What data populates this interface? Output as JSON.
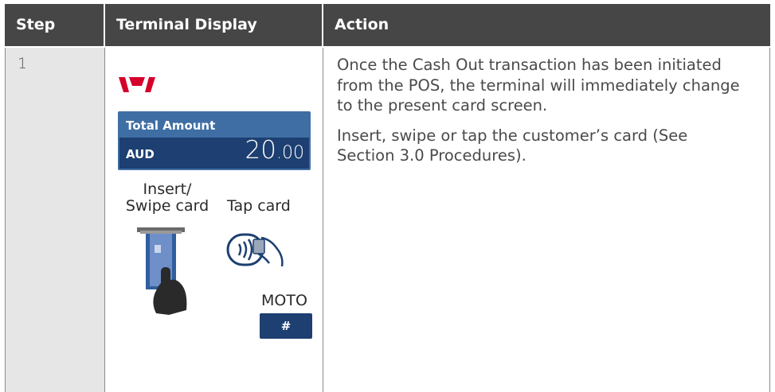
{
  "table": {
    "headers": {
      "step": "Step",
      "display": "Terminal Display",
      "action": "Action"
    },
    "rows": [
      {
        "step": "1",
        "display": {
          "amount_label": "Total Amount",
          "currency": "AUD",
          "amount_whole": "20",
          "amount_cents": ".00",
          "insert_label_line1": "Insert/",
          "insert_label_line2": "Swipe card",
          "tap_label": "Tap card",
          "moto_label": "MOTO",
          "moto_key": "#"
        },
        "action": {
          "paragraph1": "Once the Cash Out transaction has been initiated from the POS, the terminal will immediately change to the present card screen.",
          "paragraph2": "Insert, swipe or tap the customer’s card (See Section 3.0 Procedures)."
        }
      }
    ]
  },
  "colors": {
    "header_bg": "#464646",
    "step_bg": "#e7e6e6",
    "brand_red": "#d5002b",
    "amount_box": "#3f6ea4",
    "amount_dark": "#1d3f71"
  },
  "icons": {
    "logo": "westpac-logo-icon",
    "card": "insert-card-icon",
    "tap": "contactless-tap-icon"
  }
}
